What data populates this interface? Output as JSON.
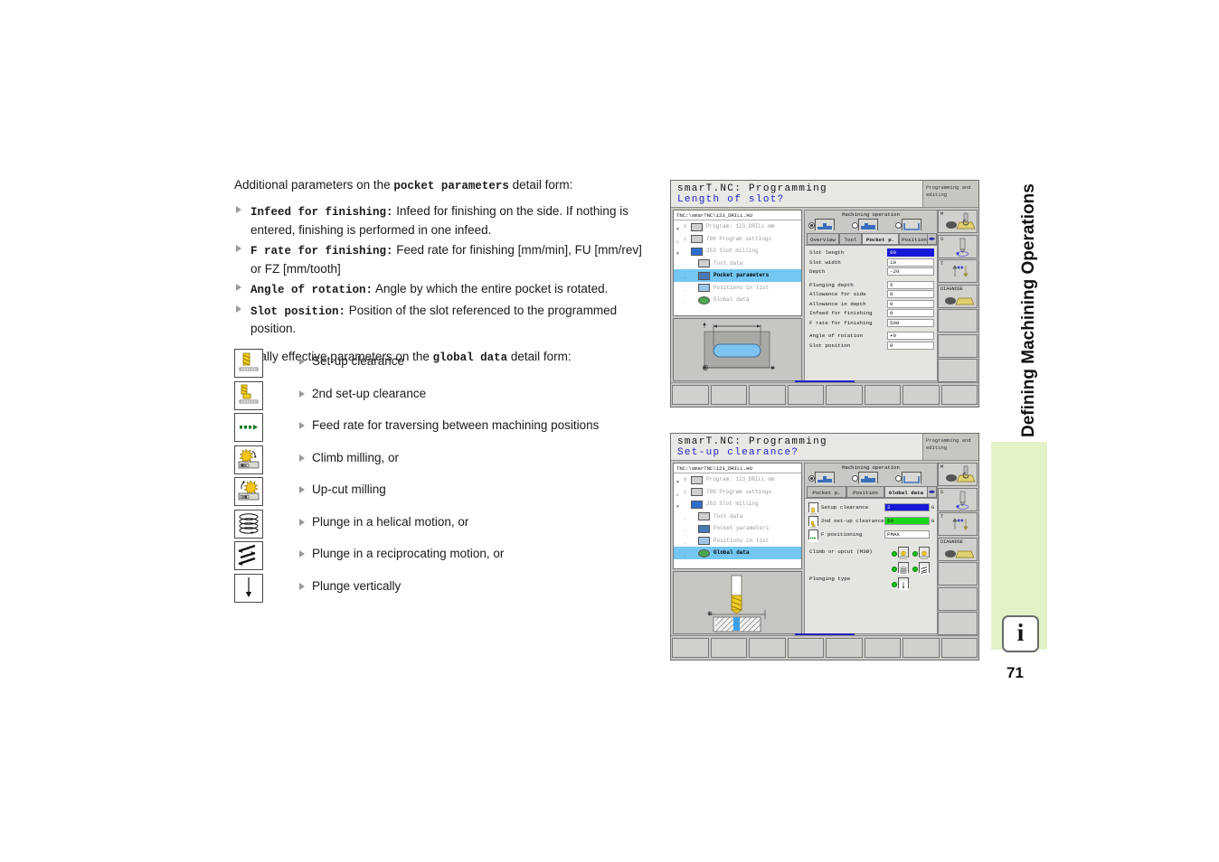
{
  "document": {
    "page_number": "71",
    "side_title": "Defining Machining Operations"
  },
  "text": {
    "intro_before": "Additional parameters on the ",
    "intro_mono": "pocket parameters",
    "intro_after": " detail form:",
    "bullets": [
      {
        "term": "Infeed for finishing:",
        "desc": " Infeed for finishing on the side. If nothing is entered, finishing is performed in one infeed."
      },
      {
        "term": "F rate for finishing:",
        "desc": " Feed rate for finishing [mm/min], FU [mm/rev] or FZ [mm/tooth]"
      },
      {
        "term": "Angle of rotation:",
        "desc": " Angle by which the entire pocket is rotated."
      },
      {
        "term": "Slot position:",
        "desc": " Position of the slot referenced to the programmed position."
      }
    ],
    "global_before": "Globally effective parameters on the ",
    "global_mono": "global data",
    "global_after": " detail form:"
  },
  "icon_list": [
    {
      "label": "Set-up clearance",
      "icon": "setup-clearance-icon"
    },
    {
      "label": "2nd set-up clearance",
      "icon": "second-setup-clearance-icon"
    },
    {
      "label": "Feed rate for traversing between machining positions",
      "icon": "feed-rate-traverse-icon"
    },
    {
      "label": "Climb milling, or",
      "icon": "climb-milling-icon"
    },
    {
      "label": "Up-cut milling",
      "icon": "upcut-milling-icon"
    },
    {
      "label": "Plunge in a helical motion, or",
      "icon": "helical-plunge-icon"
    },
    {
      "label": "Plunge in a reciprocating motion, or",
      "icon": "reciprocating-plunge-icon"
    },
    {
      "label": "Plunge vertically",
      "icon": "vertical-plunge-icon"
    }
  ],
  "screenshot1": {
    "header_title": "smarT.NC: Programming",
    "header_prompt": "Length of slot?",
    "mode_label": "Programming and editing",
    "tree_path": "TNC:\\smarTNC\\123_DRILL.HU",
    "tree": [
      {
        "num": "0",
        "label": "Program: 123_DRILL mm",
        "selected": false,
        "indent": false
      },
      {
        "num": "1",
        "label": "700 Program settings",
        "selected": false,
        "indent": false
      },
      {
        "num": "",
        "label": "253 Slot milling",
        "selected": false,
        "indent": false
      },
      {
        "num": "",
        "label": "Tool data",
        "selected": false,
        "indent": true
      },
      {
        "num": "",
        "label": "Pocket parameters",
        "selected": true,
        "indent": true
      },
      {
        "num": "",
        "label": "Positions in list",
        "selected": false,
        "indent": true
      },
      {
        "num": "",
        "label": "Global data",
        "selected": false,
        "indent": true
      }
    ],
    "machining_operation_caption": "Machining operation",
    "tabs": [
      {
        "label": "Overview",
        "active": false
      },
      {
        "label": "Tool",
        "active": false
      },
      {
        "label": "Pocket p.",
        "active": true
      },
      {
        "label": "Position",
        "active": false
      }
    ],
    "tab_arrow": "◄►",
    "fields_group1": [
      {
        "label": "Slot length",
        "value": "60",
        "highlight": "blue"
      },
      {
        "label": "Slot width",
        "value": "10",
        "highlight": "none"
      },
      {
        "label": "Depth",
        "value": "-20",
        "highlight": "none"
      }
    ],
    "fields_group2": [
      {
        "label": "Plunging depth",
        "value": "5",
        "highlight": "none"
      },
      {
        "label": "Allowance for side",
        "value": "0",
        "highlight": "none"
      },
      {
        "label": "Allowance in depth",
        "value": "0",
        "highlight": "none"
      },
      {
        "label": "Infeed for finishing",
        "value": "0",
        "highlight": "none"
      },
      {
        "label": "F rate for finishing",
        "value": "500",
        "highlight": "none"
      }
    ],
    "fields_group3": [
      {
        "label": "Angle of rotation",
        "value": "+0",
        "highlight": "none"
      },
      {
        "label": "Slot position",
        "value": "0",
        "highlight": "none"
      }
    ],
    "softkeys_right": [
      {
        "label": "M",
        "icon": "spindle-m-icon"
      },
      {
        "label": "S",
        "icon": "spindle-s-icon"
      },
      {
        "label": "T",
        "icon": "tool-t-icon"
      },
      {
        "label": "DIAGNOSE",
        "icon": "diagnose-icon"
      },
      {
        "label": "",
        "icon": ""
      },
      {
        "label": "",
        "icon": ""
      },
      {
        "label": "",
        "icon": ""
      }
    ]
  },
  "screenshot2": {
    "header_title": "smarT.NC: Programming",
    "header_prompt": "Set-up clearance?",
    "mode_label": "Programming and editing",
    "tree_path": "TNC:\\smarTNC\\123_DRILL.HU",
    "tree": [
      {
        "num": "0",
        "label": "Program: 123_DRILL mm",
        "selected": false,
        "indent": false
      },
      {
        "num": "1",
        "label": "700 Program settings",
        "selected": false,
        "indent": false
      },
      {
        "num": "",
        "label": "253 Slot milling",
        "selected": false,
        "indent": false
      },
      {
        "num": "",
        "label": "Tool data",
        "selected": false,
        "indent": true
      },
      {
        "num": "",
        "label": "Pocket parameters",
        "selected": false,
        "indent": true
      },
      {
        "num": "",
        "label": "Positions in list",
        "selected": false,
        "indent": true
      },
      {
        "num": "",
        "label": "Global data",
        "selected": true,
        "indent": true
      }
    ],
    "machining_operation_caption": "Machining operation",
    "tabs": [
      {
        "label": "Pocket p.",
        "active": false
      },
      {
        "label": "Position",
        "active": false
      },
      {
        "label": "Global data",
        "active": true
      }
    ],
    "tab_arrow": "◄►",
    "global_rows": [
      {
        "label": "Setup clearance",
        "value": "2",
        "unit": "G",
        "highlight": "blue",
        "icon": "setup-clearance-icon"
      },
      {
        "label": "2nd set-up clearance",
        "value": "50",
        "unit": "G",
        "highlight": "green",
        "icon": "second-setup-clearance-icon"
      },
      {
        "label": "F positioning",
        "value": "FMAX",
        "unit": "",
        "highlight": "none",
        "icon": "feed-rate-traverse-icon"
      }
    ],
    "climb_label": "Climb or upcut (M3Ø)",
    "plunging_label": "Plunging type",
    "softkeys_right": [
      {
        "label": "M",
        "icon": "spindle-m-icon"
      },
      {
        "label": "S",
        "icon": "spindle-s-icon"
      },
      {
        "label": "T",
        "icon": "tool-t-icon"
      },
      {
        "label": "DIAGNOSE",
        "icon": "diagnose-icon"
      },
      {
        "label": "",
        "icon": ""
      },
      {
        "label": "",
        "icon": ""
      },
      {
        "label": "",
        "icon": ""
      }
    ]
  }
}
